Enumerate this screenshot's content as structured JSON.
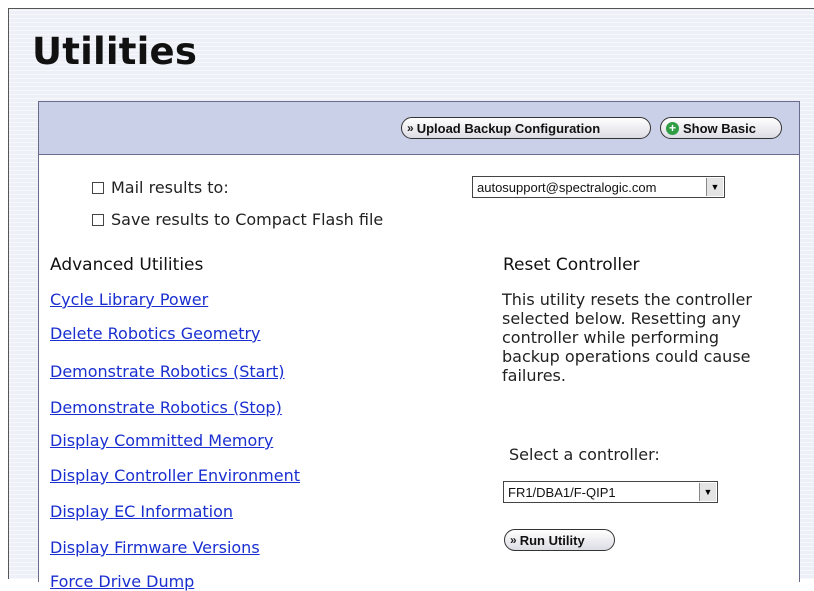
{
  "page": {
    "title": "Utilities"
  },
  "toolbar": {
    "upload_backup_label": "Upload Backup Configuration",
    "show_basic_label": "Show Basic"
  },
  "options": {
    "mail_results_label": "Mail results to:",
    "mail_results_checked": false,
    "mail_recipient_value": "autosupport@spectralogic.com",
    "save_results_label": "Save results to Compact Flash file",
    "save_results_checked": false
  },
  "advanced": {
    "heading": "Advanced Utilities",
    "links": [
      "Cycle Library Power",
      "Delete Robotics Geometry",
      "Demonstrate Robotics (Start)",
      "Demonstrate Robotics (Stop)",
      "Display Committed Memory",
      "Display Controller Environment",
      "Display EC Information",
      "Display Firmware Versions",
      "Force Drive Dump"
    ]
  },
  "reset": {
    "heading": "Reset Controller",
    "description": "This utility resets the controller selected below. Resetting any controller while performing backup operations could cause failures.",
    "select_label": "Select a controller:",
    "selected_controller": "FR1/DBA1/F-QIP1",
    "run_label": "Run Utility"
  },
  "colors": {
    "toolbar_bg": "#c9d0e8",
    "link": "#1a2fd0",
    "background": "#eef0f7"
  }
}
